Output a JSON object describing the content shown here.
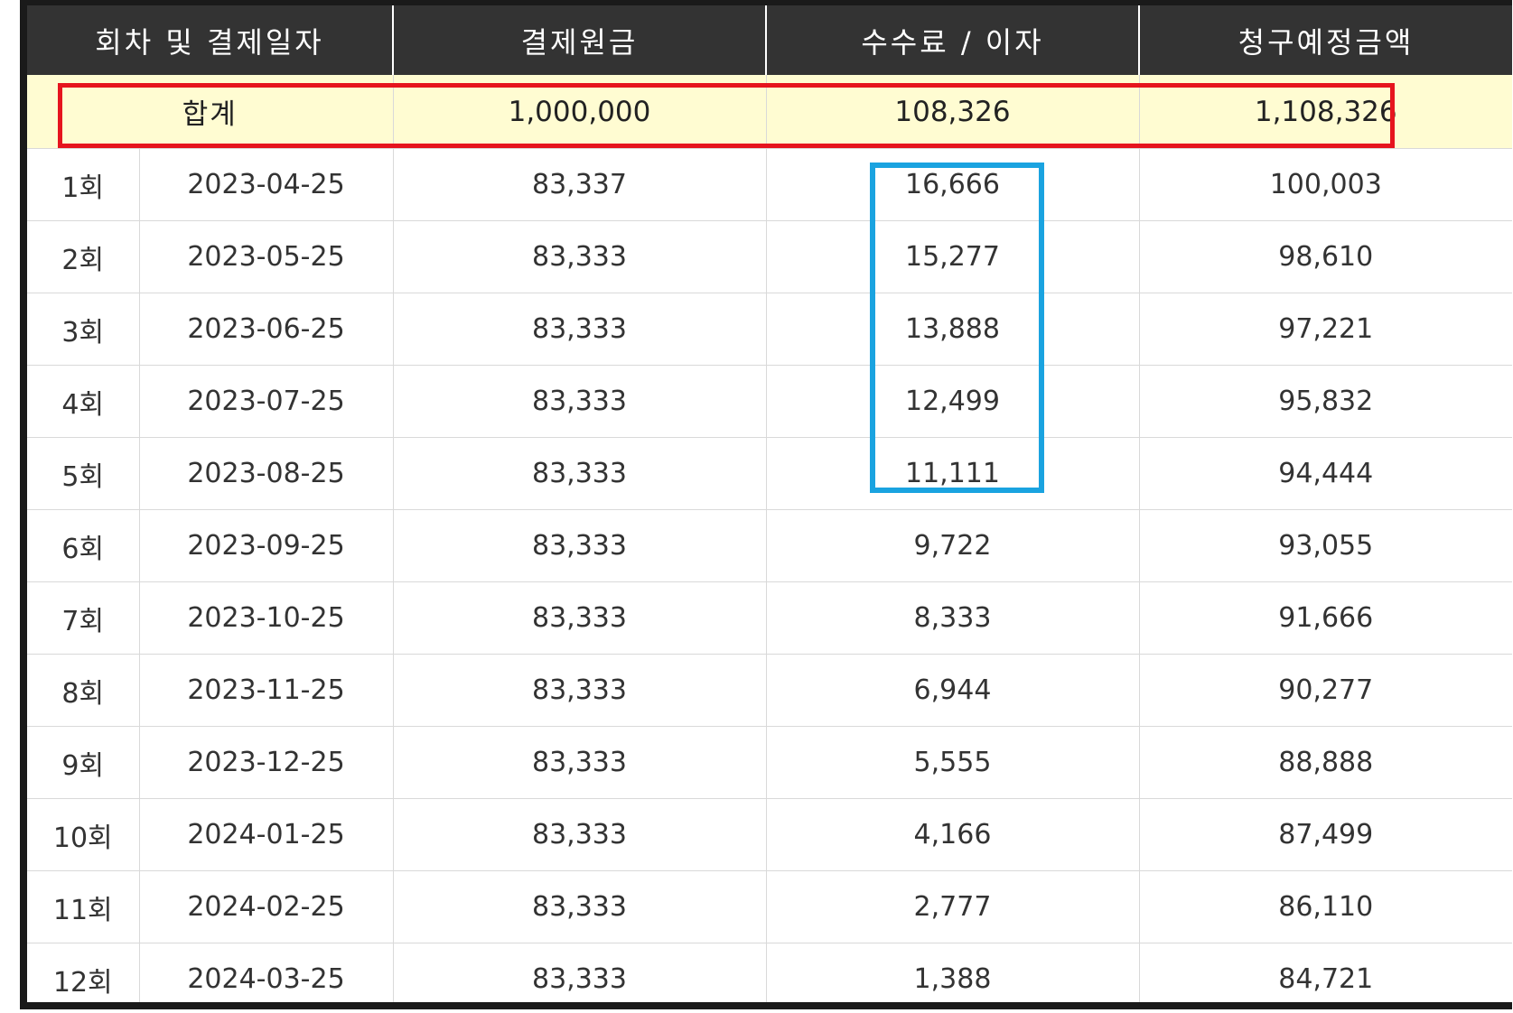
{
  "table": {
    "headers": {
      "round_date": "회차 및 결제일자",
      "principal": "결제원금",
      "fee_interest": "수수료 / 이자",
      "billing": "청구예정금액"
    },
    "total": {
      "label": "합계",
      "principal": "1,000,000",
      "fee_interest": "108,326",
      "billing": "1,108,326"
    },
    "rows": [
      {
        "round": "1회",
        "date": "2023-04-25",
        "principal": "83,337",
        "fee_interest": "16,666",
        "billing": "100,003"
      },
      {
        "round": "2회",
        "date": "2023-05-25",
        "principal": "83,333",
        "fee_interest": "15,277",
        "billing": "98,610"
      },
      {
        "round": "3회",
        "date": "2023-06-25",
        "principal": "83,333",
        "fee_interest": "13,888",
        "billing": "97,221"
      },
      {
        "round": "4회",
        "date": "2023-07-25",
        "principal": "83,333",
        "fee_interest": "12,499",
        "billing": "95,832"
      },
      {
        "round": "5회",
        "date": "2023-08-25",
        "principal": "83,333",
        "fee_interest": "11,111",
        "billing": "94,444"
      },
      {
        "round": "6회",
        "date": "2023-09-25",
        "principal": "83,333",
        "fee_interest": "9,722",
        "billing": "93,055"
      },
      {
        "round": "7회",
        "date": "2023-10-25",
        "principal": "83,333",
        "fee_interest": "8,333",
        "billing": "91,666"
      },
      {
        "round": "8회",
        "date": "2023-11-25",
        "principal": "83,333",
        "fee_interest": "6,944",
        "billing": "90,277"
      },
      {
        "round": "9회",
        "date": "2023-12-25",
        "principal": "83,333",
        "fee_interest": "5,555",
        "billing": "88,888"
      },
      {
        "round": "10회",
        "date": "2024-01-25",
        "principal": "83,333",
        "fee_interest": "4,166",
        "billing": "87,499"
      },
      {
        "round": "11회",
        "date": "2024-02-25",
        "principal": "83,333",
        "fee_interest": "2,777",
        "billing": "86,110"
      },
      {
        "round": "12회",
        "date": "2024-03-25",
        "principal": "83,333",
        "fee_interest": "1,388",
        "billing": "84,721"
      }
    ]
  },
  "highlights": {
    "total_color": "#e6141e",
    "fee_color": "#1aa3e0"
  }
}
